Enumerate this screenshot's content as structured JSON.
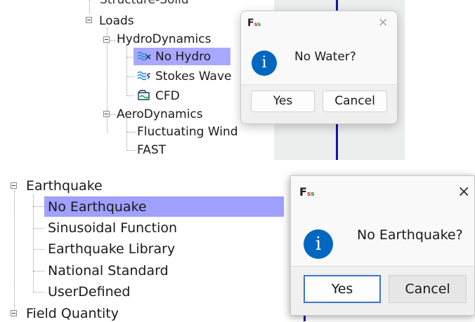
{
  "screenshot_top": {
    "tree": {
      "partial_item": "Structure-Solid",
      "loads": "Loads",
      "hydrodynamics": "HydroDynamics",
      "hydro_items": [
        "No Hydro",
        "Stokes Wave",
        "CFD"
      ],
      "aerodynamics": "AeroDynamics",
      "aero_items": [
        "Fluctuating Wind",
        "FAST"
      ]
    },
    "dialog": {
      "logo": "Fss",
      "close_glyph": "×",
      "info_glyph": "i",
      "message": "No Water?",
      "yes_label": "Yes",
      "cancel_label": "Cancel"
    }
  },
  "screenshot_bottom": {
    "tree": {
      "earthquake": "Earthquake",
      "earthquake_items": [
        "No Earthquake",
        "Sinusoidal Function",
        "Earthquake Library",
        "National Standard",
        "UserDefined"
      ],
      "field_quantity": "Field Quantity"
    },
    "dialog": {
      "logo": "Fss",
      "close_glyph": "×",
      "info_glyph": "i",
      "message": "No Earthquake?",
      "yes_label": "Yes",
      "cancel_label": "Cancel"
    }
  },
  "colors": {
    "selection": "#a8a8ff",
    "info_blue": "#0067c0",
    "default_button_border": "#3a78c9",
    "scroll_bar_blue": "#1414a8",
    "wave_icon": "#2a8fd6"
  }
}
